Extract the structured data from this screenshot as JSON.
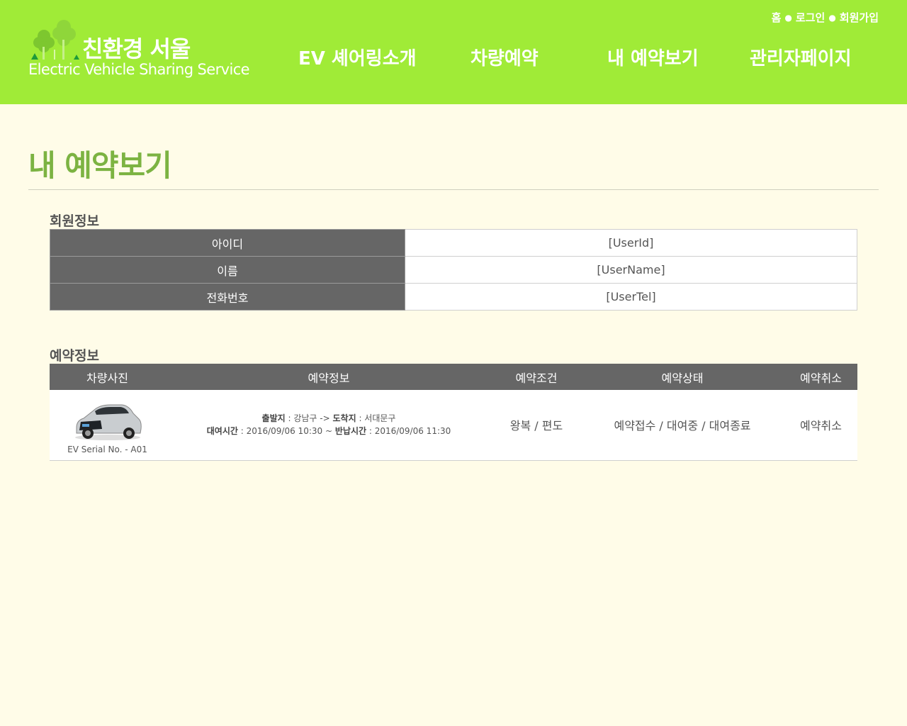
{
  "header": {
    "logo_title": "친환경 서울",
    "logo_subtitle": "Electric Vehicle Sharing Service",
    "util_links": [
      "홈",
      "로그인",
      "회원가입"
    ],
    "nav": [
      "EV 셰어링소개",
      "차량예약",
      "내 예약보기",
      "관리자페이지"
    ],
    "colors": {
      "header_bg": "#a0eb37",
      "page_bg": "#fffce8",
      "title_green": "#7cb342",
      "table_head": "#666666"
    }
  },
  "page": {
    "title": "내 예약보기"
  },
  "member": {
    "section_label": "회원정보",
    "rows": [
      {
        "label": "아이디",
        "value": "[UserId]"
      },
      {
        "label": "이름",
        "value": "[UserName]"
      },
      {
        "label": "전화번호",
        "value": "[UserTel]"
      }
    ]
  },
  "reservation": {
    "section_label": "예약정보",
    "columns": [
      "차량사진",
      "예약정보",
      "예약조건",
      "예약상태",
      "예약취소"
    ],
    "row": {
      "car_icon": "electric-car-image",
      "serial": "EV Serial No. - A01",
      "depart_label": "출발지",
      "depart_value": "강남구",
      "arrow": "->",
      "arrive_label": "도착지",
      "arrive_value": "서대문구",
      "rent_time_label": "대여시간",
      "rent_time_value": "2016/09/06 10:30",
      "tilde": "~",
      "return_time_label": "반납시간",
      "return_time_value": "2016/09/06 11:30",
      "condition": "왕복 / 편도",
      "status": "예약접수 / 대여중 / 대여종료",
      "cancel": "예약취소"
    }
  }
}
